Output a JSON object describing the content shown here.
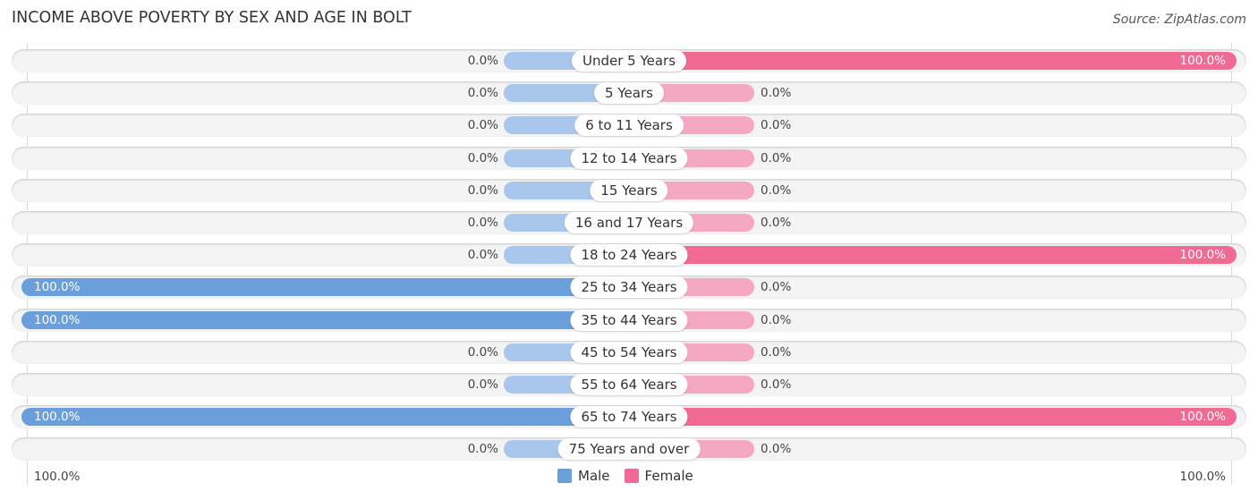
{
  "header": {
    "title": "INCOME ABOVE POVERTY BY SEX AND AGE IN BOLT",
    "source": "Source: ZipAtlas.com"
  },
  "colors": {
    "male": "#6a9fdc",
    "male_zero": "#a9c7ec",
    "female": "#f06a94",
    "female_zero": "#f5a8c1",
    "row_bg": "#f4f4f4"
  },
  "chart_data": {
    "type": "bar",
    "orientation": "horizontal-diverging",
    "title": "INCOME ABOVE POVERTY BY SEX AND AGE IN BOLT",
    "xlabel": "",
    "ylabel": "",
    "xlim": [
      -100,
      100
    ],
    "axis_labels": {
      "left": "100.0%",
      "right": "100.0%"
    },
    "legend": {
      "placement": "bottom-center",
      "entries": [
        "Male",
        "Female"
      ]
    },
    "categories": [
      "Under 5 Years",
      "5 Years",
      "6 to 11 Years",
      "12 to 14 Years",
      "15 Years",
      "16 and 17 Years",
      "18 to 24 Years",
      "25 to 34 Years",
      "35 to 44 Years",
      "45 to 54 Years",
      "55 to 64 Years",
      "65 to 74 Years",
      "75 Years and over"
    ],
    "series": [
      {
        "name": "Male",
        "values": [
          0,
          0,
          0,
          0,
          0,
          0,
          0,
          100,
          100,
          0,
          0,
          100,
          0
        ],
        "labels": [
          "0.0%",
          "0.0%",
          "0.0%",
          "0.0%",
          "0.0%",
          "0.0%",
          "0.0%",
          "100.0%",
          "100.0%",
          "0.0%",
          "0.0%",
          "100.0%",
          "0.0%"
        ]
      },
      {
        "name": "Female",
        "values": [
          100,
          0,
          0,
          0,
          0,
          0,
          100,
          0,
          0,
          0,
          0,
          100,
          0
        ],
        "labels": [
          "100.0%",
          "0.0%",
          "0.0%",
          "0.0%",
          "0.0%",
          "0.0%",
          "100.0%",
          "0.0%",
          "0.0%",
          "0.0%",
          "0.0%",
          "100.0%",
          "0.0%"
        ]
      }
    ]
  }
}
